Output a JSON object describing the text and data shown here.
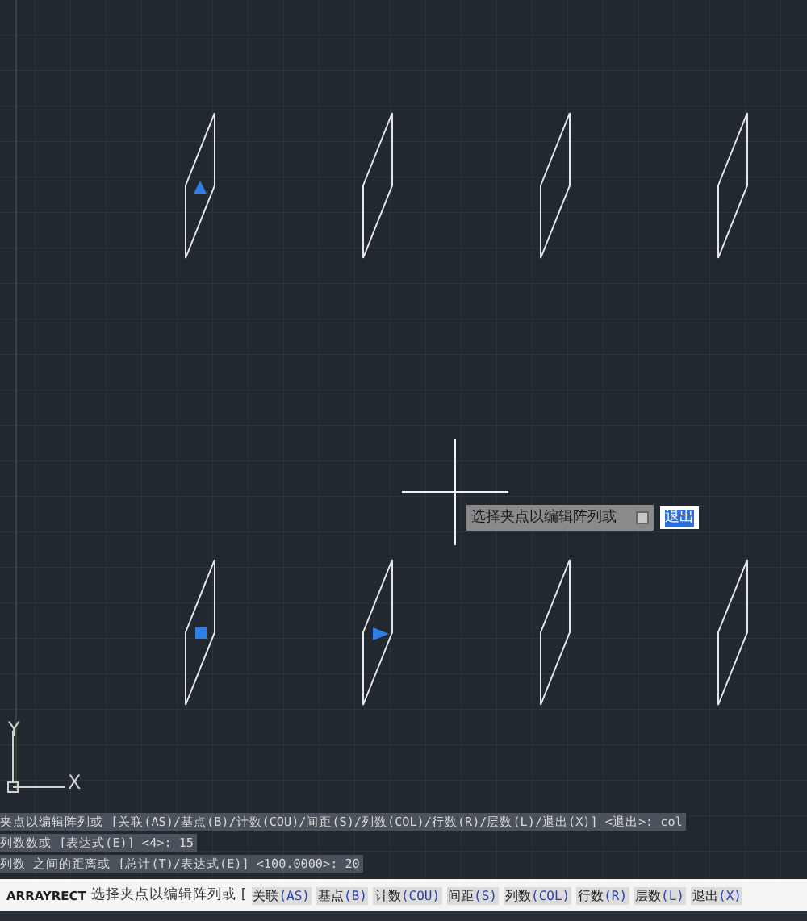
{
  "canvas": {
    "array_items": [
      {
        "kind": "triangle-up"
      },
      {
        "kind": "plain"
      },
      {
        "kind": "plain"
      },
      {
        "kind": "plain"
      },
      {
        "kind": "square"
      },
      {
        "kind": "triangle-right"
      },
      {
        "kind": "plain"
      },
      {
        "kind": "plain"
      }
    ],
    "ucs": {
      "x_label": "X",
      "y_label": "Y"
    },
    "tooltip": {
      "prompt": "选择夹点以编辑阵列或",
      "value": "退出"
    }
  },
  "history": [
    "夹点以编辑阵列或 [关联(AS)/基点(B)/计数(COU)/间距(S)/列数(COL)/行数(R)/层数(L)/退出(X)] <退出>: col",
    "列数数或 [表达式(E)] <4>: 15",
    "列数 之间的距离或 [总计(T)/表达式(E)] <100.0000>: 20"
  ],
  "command_line": {
    "command": "ARRAYRECT",
    "prompt": "选择夹点以编辑阵列或",
    "open_bracket": "[",
    "options": [
      {
        "label": "关联",
        "key": "(AS)"
      },
      {
        "label": "基点",
        "key": "(B)"
      },
      {
        "label": "计数",
        "key": "(COU)"
      },
      {
        "label": "间距",
        "key": "(S)"
      },
      {
        "label": "列数",
        "key": "(COL)"
      },
      {
        "label": "行数",
        "key": "(R)"
      },
      {
        "label": "层数",
        "key": "(L)"
      },
      {
        "label": "退出",
        "key": "(X)"
      }
    ]
  }
}
